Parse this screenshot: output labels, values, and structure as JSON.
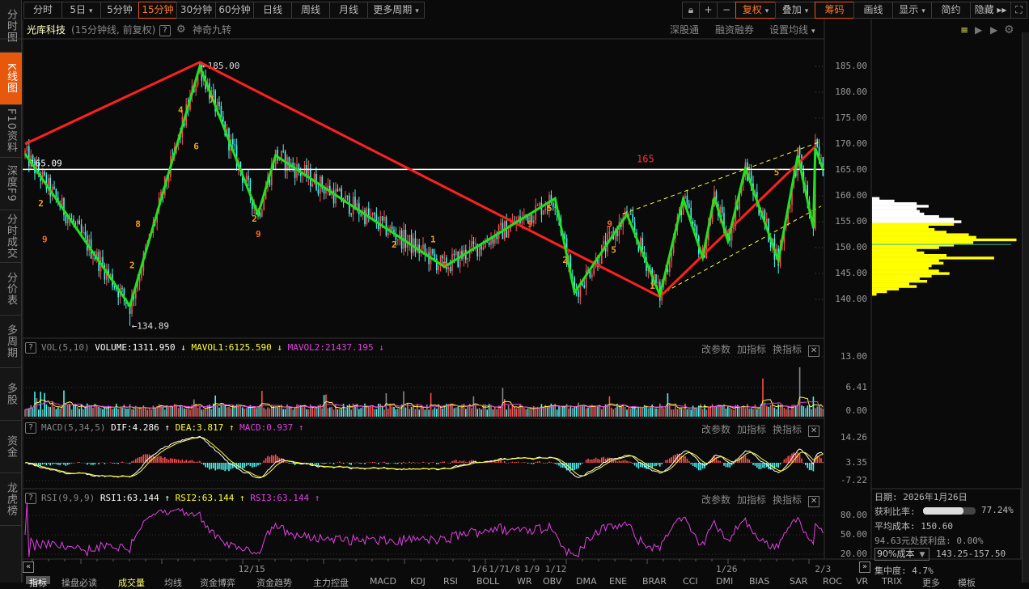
{
  "sidebar": {
    "items": [
      "分时图",
      "K线图",
      "F10资料",
      "深度F9",
      "分时成交",
      "分价表",
      "多周期",
      "多股",
      "资金",
      "龙虎榜"
    ],
    "active": 1
  },
  "periods": [
    {
      "label": "分时"
    },
    {
      "label": "5日",
      "dd": true
    },
    {
      "label": "5分钟"
    },
    {
      "label": "15分钟",
      "active": true
    },
    {
      "label": "30分钟"
    },
    {
      "label": "60分钟"
    },
    {
      "label": "日线"
    },
    {
      "label": "周线"
    },
    {
      "label": "月线"
    },
    {
      "label": "更多周期",
      "dd": true
    }
  ],
  "toolbar_right": {
    "plus": "+",
    "minus": "−",
    "fuquan": "复权",
    "diejia": "叠加",
    "chouma": "筹码",
    "huaxian": "画线",
    "xianshi": "显示",
    "jianyue": "简约",
    "yincang": "隐藏 ▸▸"
  },
  "header": {
    "stock_name": "光库科技",
    "chart_desc": "(15分钟线, 前复权)",
    "help": "?",
    "indicator": "神奇九转",
    "links": [
      "深股通",
      "融资融券",
      "设置均线"
    ]
  },
  "price_axis": {
    "ticks": [
      "185.00",
      "180.00",
      "175.00",
      "170.00",
      "165.00",
      "160.00",
      "155.00",
      "150.00",
      "145.00",
      "140.00"
    ],
    "min": 140,
    "max": 185
  },
  "price_labels": {
    "high": "←185.00",
    "low": "←134.89",
    "current_line": "165.09",
    "line_tag": "165",
    "current": 165.09
  },
  "chart_data": {
    "type": "candlestick",
    "candle_count": 412,
    "high": 185.0,
    "low": 134.89,
    "zigzag_green": [
      {
        "i": 0,
        "p": 168.1
      },
      {
        "i": 54,
        "p": 138.7
      },
      {
        "i": 90,
        "p": 185.0
      },
      {
        "i": 120,
        "p": 156.4
      },
      {
        "i": 129,
        "p": 167.8
      },
      {
        "i": 216,
        "p": 146.3
      },
      {
        "i": 273,
        "p": 159.5
      },
      {
        "i": 283,
        "p": 141.3
      },
      {
        "i": 310,
        "p": 156.4
      },
      {
        "i": 327,
        "p": 140.8
      },
      {
        "i": 339,
        "p": 159.4
      },
      {
        "i": 349,
        "p": 148.1
      },
      {
        "i": 355,
        "p": 159.7
      },
      {
        "i": 362,
        "p": 151.3
      },
      {
        "i": 371,
        "p": 165.3
      },
      {
        "i": 388,
        "p": 147.5
      },
      {
        "i": 398,
        "p": 167.8
      },
      {
        "i": 406,
        "p": 153.8
      },
      {
        "i": 407,
        "p": 169.2
      },
      {
        "i": 411,
        "p": 165.1
      }
    ],
    "zigzag_red": [
      {
        "i": 0,
        "p": 170.0
      },
      {
        "i": 90,
        "p": 185.8
      },
      {
        "i": 327,
        "p": 140.5
      },
      {
        "i": 407,
        "p": 169.5
      }
    ],
    "nine_marks": [
      {
        "i": 8,
        "p": 158,
        "t": "2"
      },
      {
        "i": 10,
        "p": 151,
        "t": "9"
      },
      {
        "i": 55,
        "p": 146,
        "t": "2"
      },
      {
        "i": 58,
        "p": 154,
        "t": "8"
      },
      {
        "i": 80,
        "p": 176,
        "t": "4"
      },
      {
        "i": 88,
        "p": 169,
        "t": "6"
      },
      {
        "i": 96,
        "p": 178,
        "t": "7"
      },
      {
        "i": 118,
        "p": 155,
        "t": "2"
      },
      {
        "i": 120,
        "p": 152,
        "t": "9"
      },
      {
        "i": 190,
        "p": 150,
        "t": "2"
      },
      {
        "i": 210,
        "p": 151,
        "t": "1"
      },
      {
        "i": 216,
        "p": 146,
        "t": "9"
      },
      {
        "i": 260,
        "p": 154,
        "t": "9"
      },
      {
        "i": 270,
        "p": 157,
        "t": "5"
      },
      {
        "i": 278,
        "p": 147,
        "t": "2"
      },
      {
        "i": 301,
        "p": 154,
        "t": "9"
      },
      {
        "i": 303,
        "p": 149,
        "t": "5"
      },
      {
        "i": 323,
        "p": 142,
        "t": "1"
      },
      {
        "i": 387,
        "p": 164,
        "t": "5"
      }
    ],
    "x_dates": [
      {
        "i": 114,
        "t": "12/15"
      },
      {
        "i": 234,
        "t": "1/6"
      },
      {
        "i": 243,
        "t": "1/7"
      },
      {
        "i": 251,
        "t": "1/8"
      },
      {
        "i": 261,
        "t": "1/9"
      },
      {
        "i": 272,
        "t": "1/12"
      },
      {
        "i": 360,
        "t": "1/26"
      },
      {
        "i": 411,
        "t": "2/3"
      }
    ]
  },
  "vol": {
    "name": "VOL(5,10)",
    "volume": "VOLUME:1311.950 ↓",
    "mavol1": "MAVOL1:6125.590 ↓",
    "mavol2": "MAVOL2:21437.195 ↓",
    "ticks": [
      "13.00",
      "6.41",
      "0.00"
    ]
  },
  "macd": {
    "name": "MACD(5,34,5)",
    "dif": "DIF:4.286 ↑",
    "dea": "DEA:3.817 ↑",
    "macd": "MACD:0.937 ↑",
    "ticks": [
      "14.26",
      "3.35",
      "-7.22"
    ]
  },
  "rsi": {
    "name": "RSI(9,9,9)",
    "rsi1": "RSI1:63.144 ↑",
    "rsi2": "RSI2:63.144 ↑",
    "rsi3": "RSI3:63.144 ↑",
    "ticks": [
      "80.00",
      "50.00",
      "20.00"
    ]
  },
  "panel_actions": {
    "modify": "改参数",
    "add": "加指标",
    "switch": "换指标",
    "close": "✕"
  },
  "chips": {
    "date": "日期: 2026年1月26日",
    "profit_ratio_label": "获利比率:",
    "profit_ratio": "77.24%",
    "profit_ratio_value": 0.7724,
    "avg_cost": "平均成本: 150.60",
    "profit_at": "94.63元处获利盘: 0.00%",
    "cost_select": "90%成本",
    "cost_range": "143.25-157.50",
    "concentration": "集中度: 4.7%",
    "avg_price": 150.6,
    "split_price": 154.5,
    "profile": [
      [
        159.5,
        0.05
      ],
      [
        159,
        0.15
      ],
      [
        158.5,
        0.3
      ],
      [
        158,
        0.38
      ],
      [
        157.5,
        0.3
      ],
      [
        157,
        0.32
      ],
      [
        156.5,
        0.35
      ],
      [
        156,
        0.45
      ],
      [
        155.5,
        0.55
      ],
      [
        155,
        0.6
      ],
      [
        154.5,
        0.55
      ],
      [
        154,
        0.38
      ],
      [
        153.5,
        0.42
      ],
      [
        153,
        0.5
      ],
      [
        152.5,
        0.65
      ],
      [
        152,
        0.7
      ],
      [
        151.5,
        0.97
      ],
      [
        151,
        0.68
      ],
      [
        150.5,
        0.55
      ],
      [
        150,
        0.45
      ],
      [
        149.5,
        0.3
      ],
      [
        149,
        0.35
      ],
      [
        148.5,
        0.5
      ],
      [
        148,
        0.82
      ],
      [
        147.5,
        0.45
      ],
      [
        147,
        0.48
      ],
      [
        146.5,
        0.4
      ],
      [
        146,
        0.38
      ],
      [
        145.5,
        0.45
      ],
      [
        145,
        0.52
      ],
      [
        144.5,
        0.4
      ],
      [
        144,
        0.32
      ],
      [
        143.5,
        0.37
      ],
      [
        143,
        0.25
      ],
      [
        142.5,
        0.3
      ],
      [
        142,
        0.18
      ],
      [
        141.5,
        0.1
      ],
      [
        141,
        0.03
      ]
    ]
  },
  "bottom_tabs": [
    "指标",
    "操盘必读",
    "成交量",
    "均线",
    "资金博弈",
    "资金趋势",
    "主力控盘",
    "MACD",
    "KDJ",
    "RSI",
    "BOLL",
    "WR",
    "OBV",
    "DMA",
    "ENE",
    "BRAR",
    "CCI",
    "DMI",
    "BIAS",
    "SAR",
    "ROC",
    "VR",
    "TRIX",
    "更多",
    "模板"
  ],
  "colors": {
    "up": "#ff4d4d",
    "down": "#4ff0f0",
    "green_line": "#22e022",
    "red_line": "#ff2020",
    "accent": "#e8580c",
    "yellow": "#ffff33",
    "magenta": "#e040e0"
  }
}
